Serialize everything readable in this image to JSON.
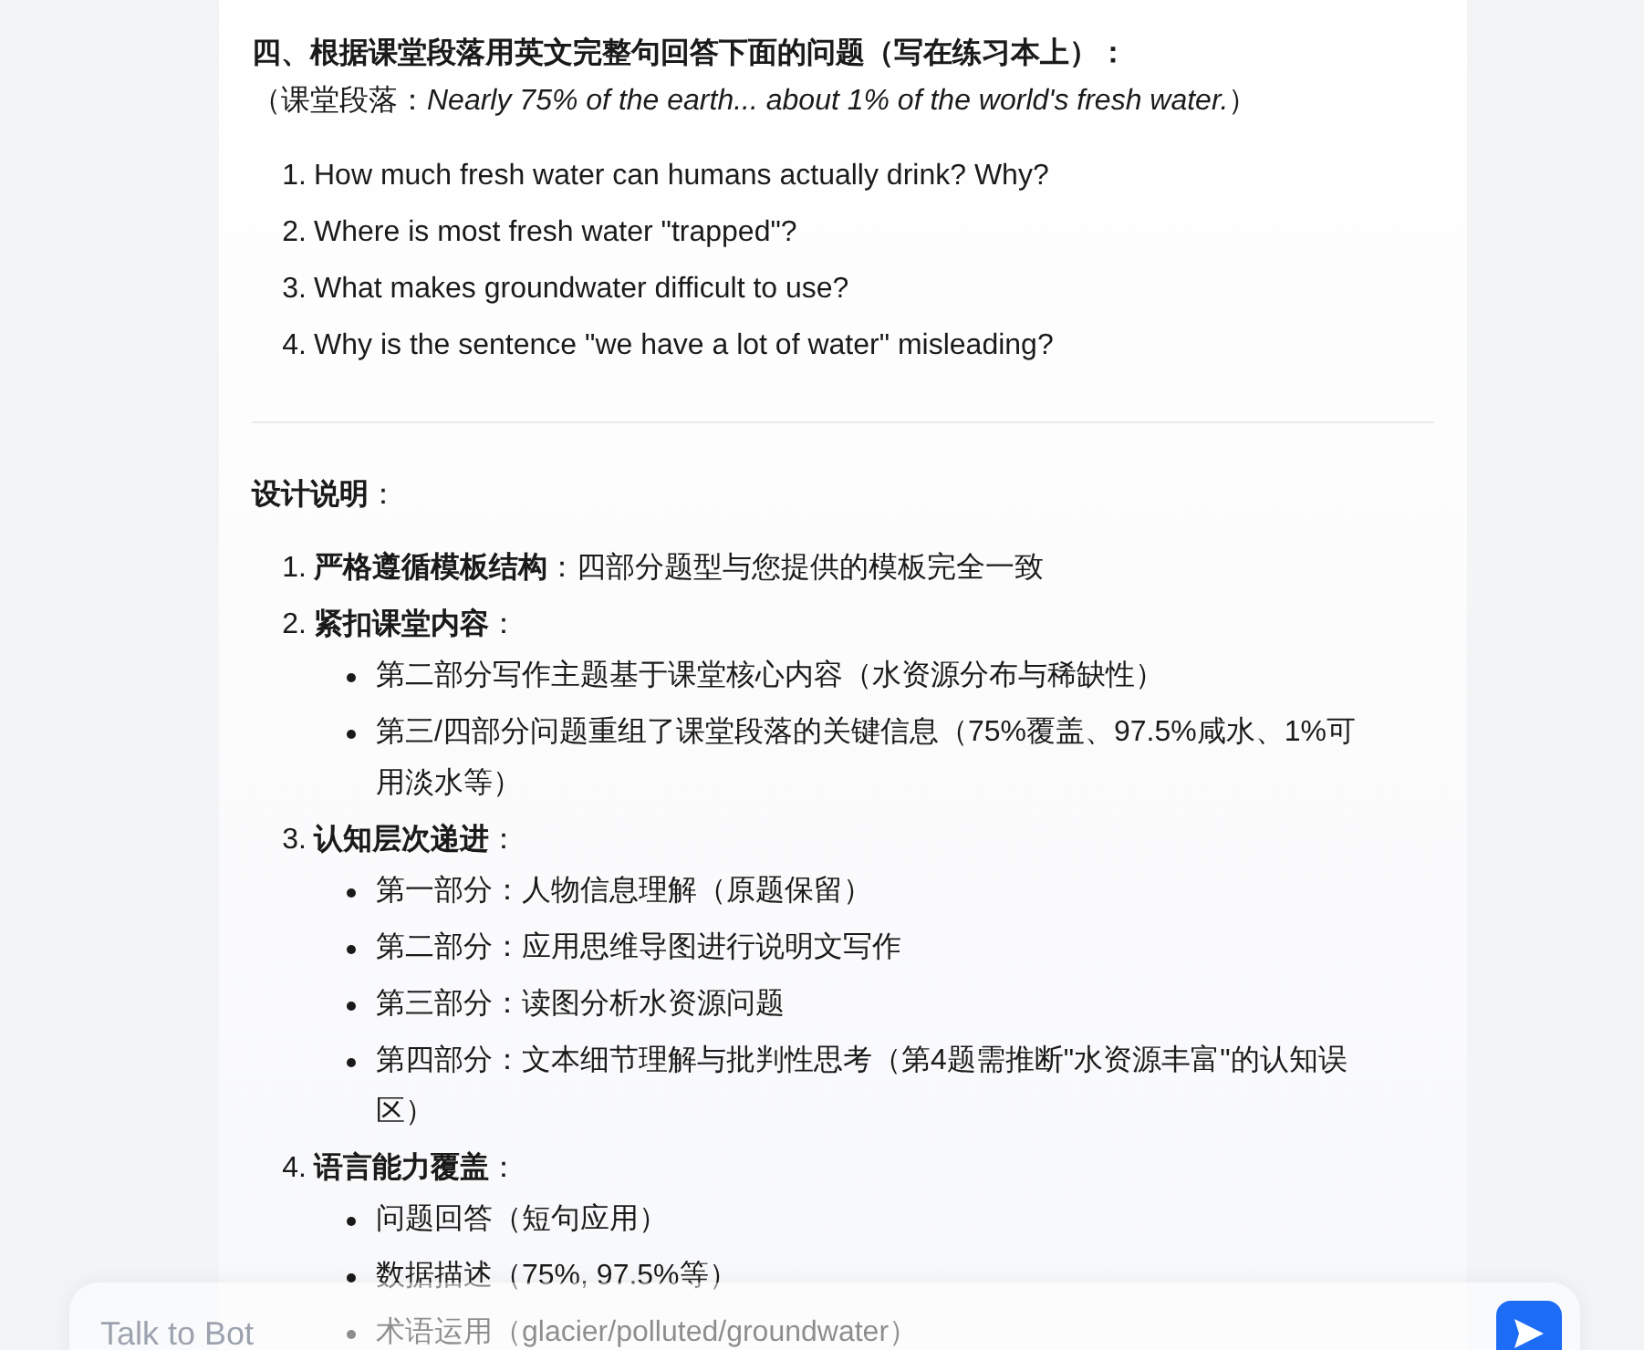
{
  "section_four": {
    "heading": "四、根据课堂段落用英文完整句回答下面的问题（写在练习本上）：",
    "passage_note": "（课堂段落：*Nearly 75% of the earth... about 1% of the world's fresh water.*）",
    "questions": [
      {
        "number": "1.",
        "text": "How much fresh water can humans actually drink? Why?"
      },
      {
        "number": "2.",
        "text": "Where is most fresh water \"trapped\"?"
      },
      {
        "number": "3.",
        "text": "What makes groundwater difficult to use?"
      },
      {
        "number": "4.",
        "text": "Why is the sentence \"we have a lot of water\" misleading?"
      }
    ]
  },
  "design_notes": {
    "heading": "**设计说明**：",
    "items": [
      {
        "number": "1.",
        "text": "**严格遵循模板结构**：四部分题型与您提供的模板完全一致"
      },
      {
        "number": "2.",
        "text": "**紧扣课堂内容**：",
        "children": [
          {
            "text": "第二部分写作主题基于课堂核心内容（水资源分布与稀缺性）"
          },
          {
            "text": "第三/四部分问题重组了课堂段落的关键信息（75%覆盖、97.5%咸水、1%可用淡水等）"
          }
        ]
      },
      {
        "number": "3.",
        "text": "**认知层次递进**：",
        "children": [
          {
            "text": "第一部分：人物信息理解（原题保留）"
          },
          {
            "text": "第二部分：应用思维导图进行说明文写作"
          },
          {
            "text": "第三部分：读图分析水资源问题"
          },
          {
            "text": "第四部分：文本细节理解与批判性思考（第4题需推断\"水资源丰富\"的认知误区）"
          }
        ]
      },
      {
        "number": "4.",
        "text": "**语言能力覆盖**：",
        "children": [
          {
            "text": "问题回答（短句应用）"
          },
          {
            "text": "数据描述（75%, 97.5%等）"
          },
          {
            "text": "术语运用（glacier/polluted/groundwater）"
          }
        ]
      }
    ]
  },
  "chat_input": {
    "placeholder": "Talk to Bot"
  }
}
